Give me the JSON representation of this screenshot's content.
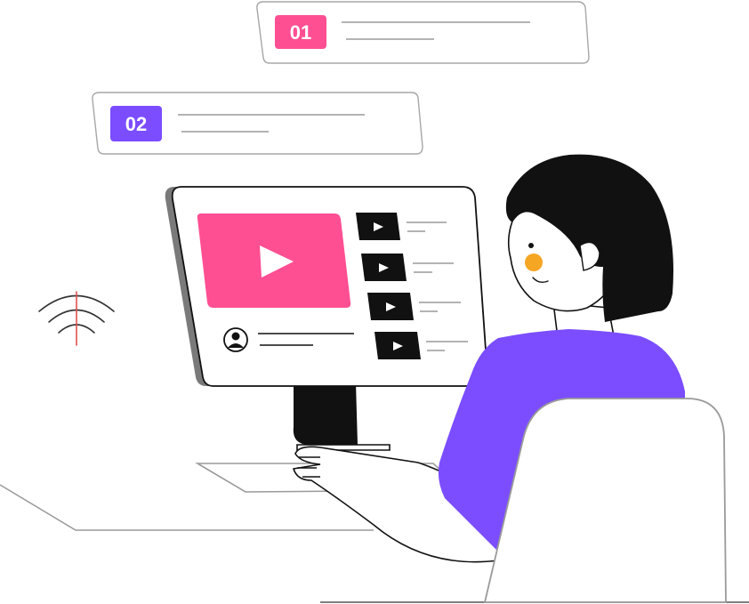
{
  "cards": [
    {
      "number": "01",
      "color": "#ff4f93"
    },
    {
      "number": "02",
      "color": "#7b4dff"
    }
  ],
  "colors": {
    "accent_pink": "#ff4f93",
    "accent_purple": "#7b4dff",
    "cheek": "#f5a623",
    "ink": "#111111",
    "outline": "#9a9a9a"
  },
  "icons": {
    "video_player": "play-icon",
    "playlist": "play-icon",
    "channel": "user-avatar-icon",
    "signal": "wifi-signal-icon"
  },
  "playlist_items": 4
}
